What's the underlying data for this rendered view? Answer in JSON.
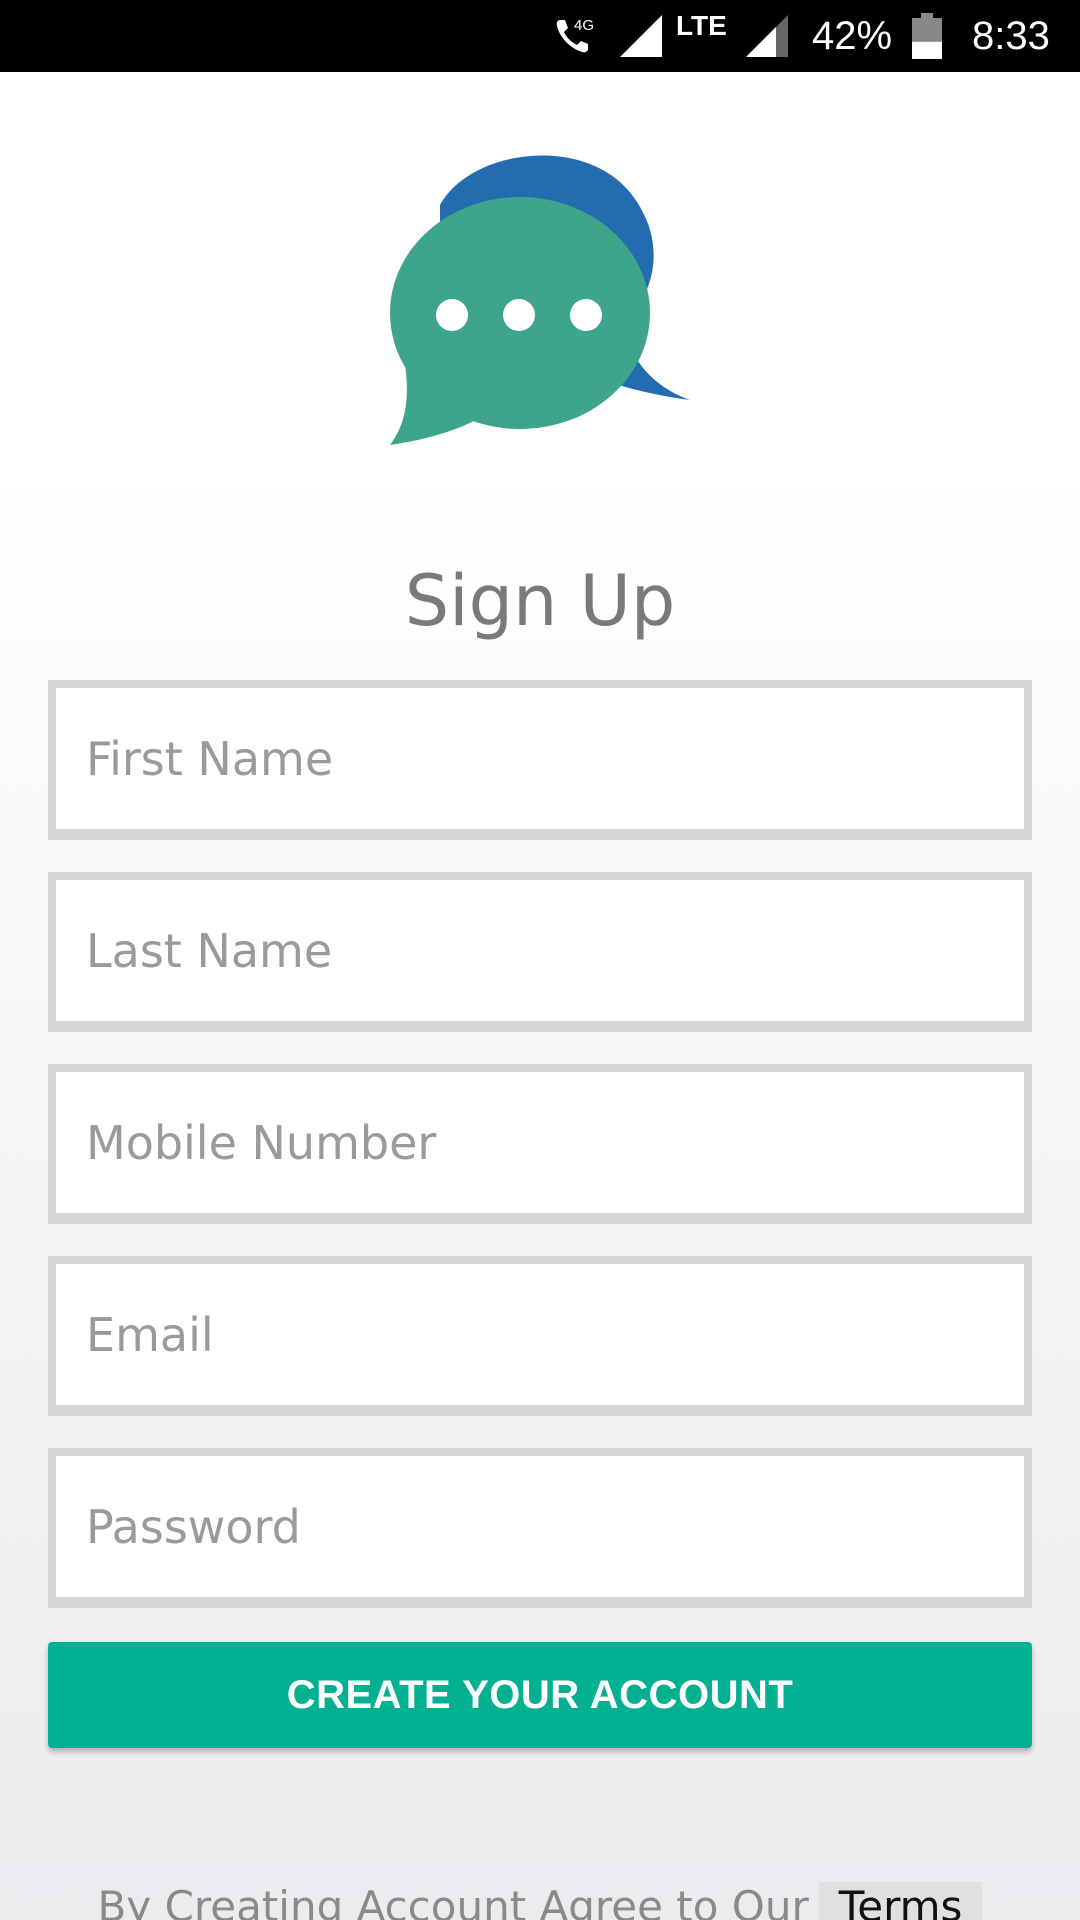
{
  "status_bar": {
    "network": "LTE",
    "call_badge": "4G",
    "battery_percent": "42%",
    "battery_level": 0.42,
    "time": "8:33"
  },
  "page": {
    "title": "Sign Up",
    "logo_icon": "chat-bubbles-icon",
    "colors": {
      "accent": "#03b091",
      "logo_back_bubble": "#246cb0",
      "logo_front_bubble": "#3ea58a"
    }
  },
  "form": {
    "first_name": {
      "placeholder": "First Name",
      "value": ""
    },
    "last_name": {
      "placeholder": "Last Name",
      "value": ""
    },
    "mobile": {
      "placeholder": "Mobile Number",
      "value": ""
    },
    "email": {
      "placeholder": "Email",
      "value": ""
    },
    "password": {
      "placeholder": "Password",
      "value": ""
    },
    "submit_label": "CREATE YOUR ACCOUNT"
  },
  "footer": {
    "agree_text": "By Creating Account Agree to Our",
    "terms_link": "Terms"
  }
}
